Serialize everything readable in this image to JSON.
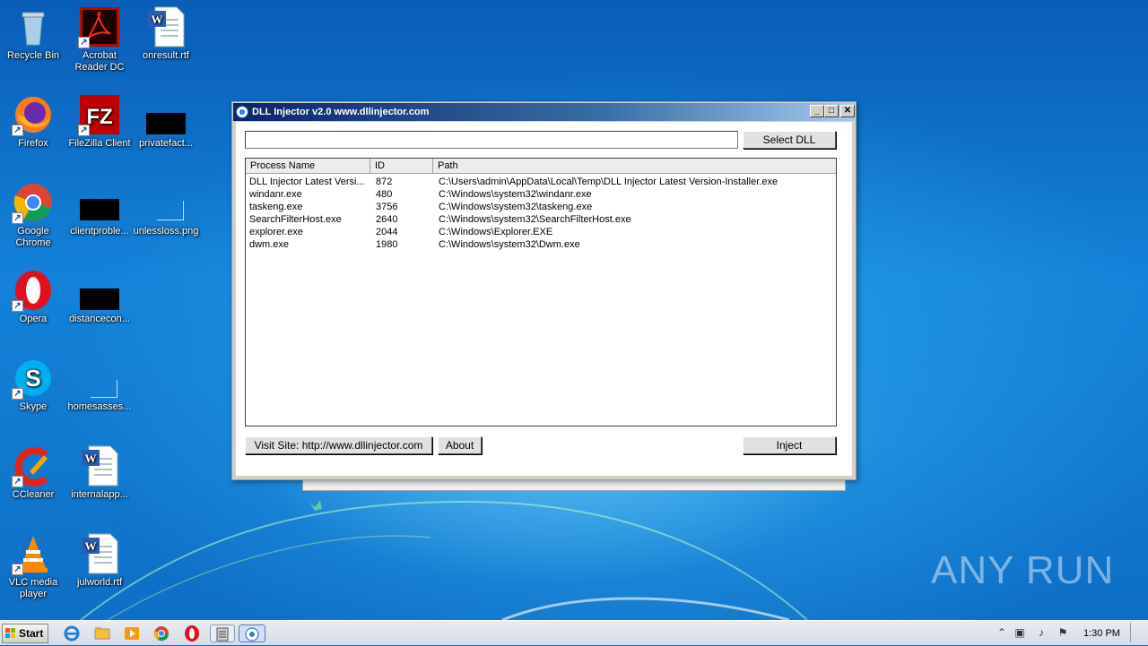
{
  "desktop": {
    "icons": [
      {
        "label": "Recycle Bin"
      },
      {
        "label": "Acrobat Reader DC"
      },
      {
        "label": "onresult.rtf"
      },
      {
        "label": "Firefox"
      },
      {
        "label": "FileZilla Client"
      },
      {
        "label": "privatefact..."
      },
      {
        "label": "Google Chrome"
      },
      {
        "label": "clientproble..."
      },
      {
        "label": "unlessloss.png"
      },
      {
        "label": "Opera"
      },
      {
        "label": "distancecon..."
      },
      {
        "label": "Skype"
      },
      {
        "label": "homesasses..."
      },
      {
        "label": "CCleaner"
      },
      {
        "label": "internalapp..."
      },
      {
        "label": "VLC media player"
      },
      {
        "label": "julworld.rtf"
      }
    ],
    "watermark": "ANY RUN"
  },
  "window": {
    "title": "DLL Injector v2.0 www.dllinjector.com",
    "controls": {
      "minimize": "_",
      "maximize": "□",
      "close": "✕"
    },
    "dll_path_value": "",
    "select_dll_label": "Select DLL",
    "columns": [
      "Process Name",
      "ID",
      "Path"
    ],
    "processes": [
      {
        "name": "DLL Injector Latest Versi...",
        "id": "872",
        "path": "C:\\Users\\admin\\AppData\\Local\\Temp\\DLL Injector Latest Version-Installer.exe"
      },
      {
        "name": "windanr.exe",
        "id": "480",
        "path": "C:\\Windows\\system32\\windanr.exe"
      },
      {
        "name": "taskeng.exe",
        "id": "3756",
        "path": "C:\\Windows\\system32\\taskeng.exe"
      },
      {
        "name": "SearchFilterHost.exe",
        "id": "2640",
        "path": "C:\\Windows\\system32\\SearchFilterHost.exe"
      },
      {
        "name": "explorer.exe",
        "id": "2044",
        "path": "C:\\Windows\\Explorer.EXE"
      },
      {
        "name": "dwm.exe",
        "id": "1980",
        "path": "C:\\Windows\\system32\\Dwm.exe"
      }
    ],
    "visit_site_label": "Visit Site: http://www.dllinjector.com",
    "about_label": "About",
    "inject_label": "Inject"
  },
  "taskbar": {
    "start_label": "Start",
    "clock": "1:30 PM"
  }
}
